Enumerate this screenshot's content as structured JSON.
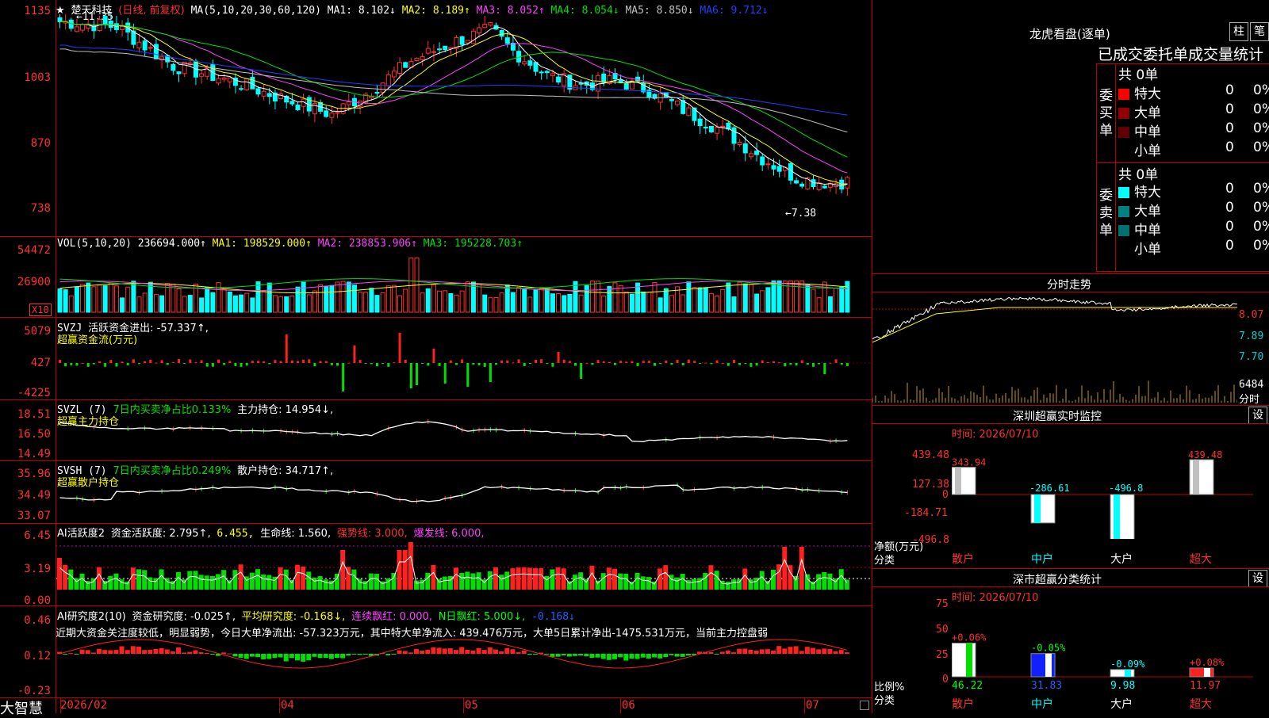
{
  "stock": {
    "star": "★",
    "name": "楚天科技",
    "period": "(日线, 前复权)"
  },
  "ma_header": {
    "label": "MA(5,10,20,30,60,120)",
    "items": [
      {
        "text": "MA1: 8.102↓",
        "color": "#ffffff"
      },
      {
        "text": "MA2: 8.189↑",
        "color": "#ffff00"
      },
      {
        "text": "MA3: 8.052↑",
        "color": "#ff40ff"
      },
      {
        "text": "MA4: 8.054↓",
        "color": "#00e000"
      },
      {
        "text": "MA5: 8.850↓",
        "color": "#c0c0c0"
      },
      {
        "text": "MA6: 9.712↓",
        "color": "#2040ff"
      }
    ]
  },
  "price_axis": [
    "1135",
    "1003",
    "870",
    "738"
  ],
  "price_annotations": {
    "high": "←11.35",
    "low": "←7.38"
  },
  "vol_header": {
    "label": "VOL(5,10,20)",
    "value": "236694.000↑",
    "ma1": "MA1: 198529.000↑",
    "ma2": "MA2: 238853.906↑",
    "ma3": "MA3: 195228.703↑"
  },
  "vol_axis": [
    "54472",
    "26900"
  ],
  "vol_unit": "X10",
  "svzj_header": {
    "label": "SVZJ",
    "text": "活跃资金进出: -57.337↑,",
    "sub": "超赢资金流(万元)"
  },
  "svzj_axis": [
    "5079",
    "427",
    "-4225"
  ],
  "svzl_header": {
    "label": "SVZL (7)",
    "text": "7日内买卖净占比0.133%",
    "hold": "主力持仓: 14.954↓,",
    "sub": "超赢主力持仓"
  },
  "svzl_axis": [
    "18.51",
    "16.50",
    "14.49"
  ],
  "svsh_header": {
    "label": "SVSH (7)",
    "text": "7日内买卖净占比0.249%",
    "hold": "散户持仓: 34.717↑,",
    "sub": "超赢散户持仓"
  },
  "svsh_axis": [
    "35.96",
    "34.49",
    "33.07"
  ],
  "ai1_header": {
    "label": "AI活跃度2",
    "a": "资金活跃度: 2.795↑,",
    "b": "6.455,",
    "c": "生命线: 1.560,",
    "d": "强势线: 3.000,",
    "e": "爆发线: 6.000,"
  },
  "ai1_axis": [
    "6.45",
    "3.19",
    "0.00"
  ],
  "ai2_header": {
    "label": "AI研究度2(10)",
    "a": "资金研究度: -0.025↑,",
    "b": "平均研究度: -0.168↓,",
    "c": "连续飘红: 0.000,",
    "d": "N日飘红: 5.000↓,",
    "e": "-0.168↓"
  },
  "ai2_text": "近期大资金关注度较低，明显弱势，今日大单净流出: -57.323万元，其中特大单净流入: 439.476万元，大单5日累计净出-1475.531万元，当前主力控盘弱",
  "ai2_axis": [
    "0.46",
    "0.12",
    "-0.23"
  ],
  "date_axis": [
    "2026/02",
    "04",
    "05",
    "06",
    "07"
  ],
  "brand": "大智慧",
  "right": {
    "title": "龙虎看盘(逐单)",
    "tab1": "柱",
    "tab2": "笔",
    "stat_title": "已成交委托单成交量统计",
    "buy_label": "委买单",
    "sell_label": "委卖单",
    "buy_total": "共 0单",
    "sell_total": "共 0单",
    "buy_rows": [
      {
        "name": "特大",
        "val": "0",
        "pct": "0%",
        "color": "#ff0000"
      },
      {
        "name": "大单",
        "val": "0",
        "pct": "0%",
        "color": "#900000"
      },
      {
        "name": "中单",
        "val": "0",
        "pct": "0%",
        "color": "#600000"
      },
      {
        "name": "小单",
        "val": "0",
        "pct": "0%",
        "color": "#000000"
      }
    ],
    "sell_rows": [
      {
        "name": "特大",
        "val": "0",
        "pct": "0%",
        "color": "#00ffff"
      },
      {
        "name": "大单",
        "val": "0",
        "pct": "0%",
        "color": "#008080"
      },
      {
        "name": "中单",
        "val": "0",
        "pct": "0%",
        "color": "#007070"
      },
      {
        "name": "小单",
        "val": "0",
        "pct": "0%",
        "color": "#000000"
      }
    ],
    "intraday_title": "分时走势",
    "intraday_axis": [
      "8.07",
      "7.89",
      "7.70",
      "6484"
    ],
    "intraday_unit": "分时",
    "monitor_title": "深圳超赢实时监控",
    "monitor_time": "时间: 2026/07/10",
    "monitor_axis": [
      "439.48",
      "127.38",
      "0",
      "-184.71",
      "-496.8"
    ],
    "monitor_unit": "净额(万元)",
    "monitor_unit2": "分类",
    "monitor_vals": [
      "343.94",
      "-286.61",
      "-496.8",
      "439.48"
    ],
    "categories": [
      "散户",
      "中户",
      "大户",
      "超大"
    ],
    "class_title": "深市超赢分类统计",
    "class_time": "时间: 2026/07/10",
    "class_axis": [
      "75",
      "50",
      "25",
      "0"
    ],
    "class_unit": "比例%",
    "class_unit2": "分类",
    "class_top": [
      "+0.06%",
      "-0.05%",
      "-0.09%",
      "+0.08%"
    ],
    "class_vals": [
      "46.22",
      "31.83",
      "9.98",
      "11.97"
    ],
    "set_label": "设"
  }
}
